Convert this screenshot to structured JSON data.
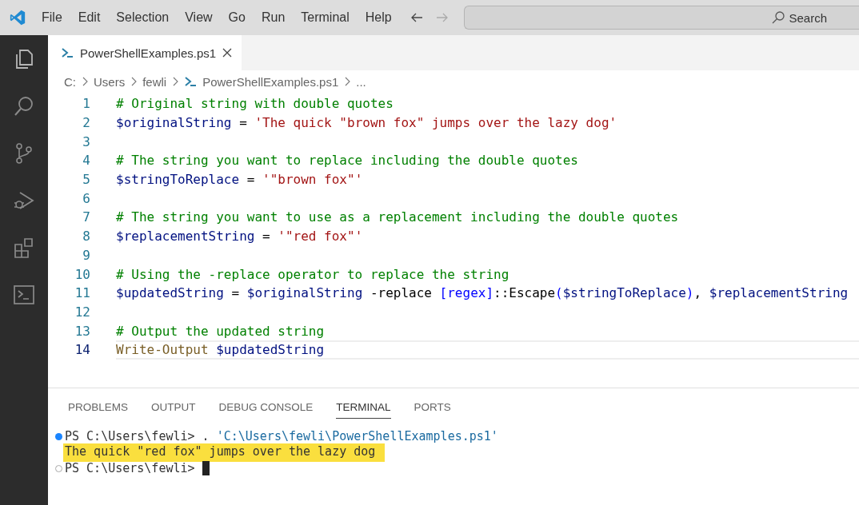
{
  "menu": [
    "File",
    "Edit",
    "Selection",
    "View",
    "Go",
    "Run",
    "Terminal",
    "Help"
  ],
  "search": {
    "placeholder": "Search"
  },
  "tabs": [
    {
      "label": "PowerShellExamples.ps1",
      "selected": true
    }
  ],
  "breadcrumb": [
    {
      "label": "C:",
      "kind": "folder"
    },
    {
      "label": "Users",
      "kind": "folder"
    },
    {
      "label": "fewli",
      "kind": "folder"
    },
    {
      "label": "PowerShellExamples.ps1",
      "kind": "file"
    },
    {
      "label": "...",
      "kind": "more"
    }
  ],
  "editor": {
    "lines": [
      {
        "number": "1",
        "current": false,
        "tokens": [
          {
            "kind": "comment",
            "text": "# Original string with double quotes"
          }
        ]
      },
      {
        "number": "2",
        "current": false,
        "tokens": [
          {
            "kind": "variable",
            "text": "$originalString"
          },
          {
            "kind": "plain",
            "text": " = "
          },
          {
            "kind": "string",
            "text": "'The quick \"brown fox\" jumps over the lazy dog'"
          }
        ]
      },
      {
        "number": "3",
        "current": false
      },
      {
        "number": "4",
        "current": false,
        "tokens": [
          {
            "kind": "comment",
            "text": "# The string you want to replace including the double quotes"
          }
        ]
      },
      {
        "number": "5",
        "current": false,
        "tokens": [
          {
            "kind": "variable",
            "text": "$stringToReplace"
          },
          {
            "kind": "plain",
            "text": " = "
          },
          {
            "kind": "string",
            "text": "'\"brown fox\"'"
          }
        ]
      },
      {
        "number": "6",
        "current": false
      },
      {
        "number": "7",
        "current": false,
        "tokens": [
          {
            "kind": "comment",
            "text": "# The string you want to use as a replacement including the double quotes"
          }
        ]
      },
      {
        "number": "8",
        "current": false,
        "tokens": [
          {
            "kind": "variable",
            "text": "$replacementString"
          },
          {
            "kind": "plain",
            "text": " = "
          },
          {
            "kind": "string",
            "text": "'\"red fox\"'"
          }
        ]
      },
      {
        "number": "9",
        "current": false
      },
      {
        "number": "10",
        "current": false,
        "tokens": [
          {
            "kind": "comment",
            "text": "# Using the -replace operator to replace the string"
          }
        ]
      },
      {
        "number": "11",
        "current": false,
        "tokens": [
          {
            "kind": "variable",
            "text": "$updatedString"
          },
          {
            "kind": "plain",
            "text": " = "
          },
          {
            "kind": "variable",
            "text": "$originalString"
          },
          {
            "kind": "plain",
            "text": " -replace "
          },
          {
            "kind": "type",
            "text": "[regex]"
          },
          {
            "kind": "plain",
            "text": "::Escape"
          },
          {
            "kind": "type",
            "text": "("
          },
          {
            "kind": "variable",
            "text": "$stringToReplace"
          },
          {
            "kind": "type",
            "text": ")"
          },
          {
            "kind": "plain",
            "text": ", "
          },
          {
            "kind": "variable",
            "text": "$replacementString"
          }
        ]
      },
      {
        "number": "12",
        "current": false
      },
      {
        "number": "13",
        "current": false,
        "tokens": [
          {
            "kind": "comment",
            "text": "# Output the updated string"
          }
        ]
      },
      {
        "number": "14",
        "current": true,
        "tokens": [
          {
            "kind": "function",
            "text": "Write-Output"
          },
          {
            "kind": "variable",
            "text": " $updatedString"
          }
        ]
      }
    ]
  },
  "panel": {
    "tabs": [
      {
        "label": "PROBLEMS",
        "selected": false
      },
      {
        "label": "OUTPUT",
        "selected": false
      },
      {
        "label": "DEBUG CONSOLE",
        "selected": false
      },
      {
        "label": "TERMINAL",
        "selected": true
      },
      {
        "label": "PORTS",
        "selected": false
      }
    ],
    "terminal": [
      {
        "kind": "command",
        "highlighted": false,
        "prompt": "PS C:\\Users\\fewli>",
        "command": ". 'C:\\Users\\fewli\\PowerShellExamples.ps1'"
      },
      {
        "kind": "output",
        "highlighted": true,
        "text": "The quick \"red fox\" jumps over the lazy dog"
      },
      {
        "kind": "prompt",
        "highlighted": false,
        "prompt": "PS C:\\Users\\fewli>"
      }
    ]
  }
}
